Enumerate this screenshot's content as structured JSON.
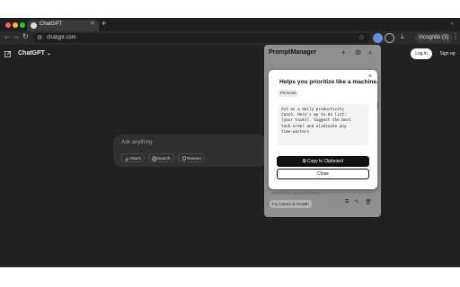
{
  "browser": {
    "tab_title": "ChatGPT",
    "tab_close": "×",
    "new_tab": "+",
    "url": "chatgpt.com",
    "profile_label": "Incognito (3)"
  },
  "app": {
    "title": "ChatGPT",
    "title_chevron": "⌄",
    "login_label": "Log in",
    "signup_label": "Sign up",
    "composer": {
      "placeholder": "Ask anything",
      "buttons": [
        {
          "label": "Attach",
          "icon": "paperclip-icon"
        },
        {
          "label": "Search",
          "icon": "globe-icon"
        },
        {
          "label": "Reason",
          "icon": "lightbulb-icon"
        }
      ]
    }
  },
  "prompt_manager": {
    "title": "PromptManager",
    "faint_text": "experience. Suggest the best...",
    "card_tag": "For Career & Growth",
    "modal": {
      "title": "Helps you prioritize like a machine.",
      "badge": "Personal",
      "prompt_lines": [
        "Act as a daily productivity",
        "coach. Here's my to-do list:",
        "[your tasks]. Suggest the best",
        "task order and eliminate any",
        "time-wasters."
      ],
      "copy_label": "Copy to Clipboard",
      "close_label": "Close",
      "close_x": "×"
    }
  },
  "colors": {
    "app_bg": "#212121",
    "chrome_bg": "#1f1f1f",
    "accent": "#111111"
  }
}
